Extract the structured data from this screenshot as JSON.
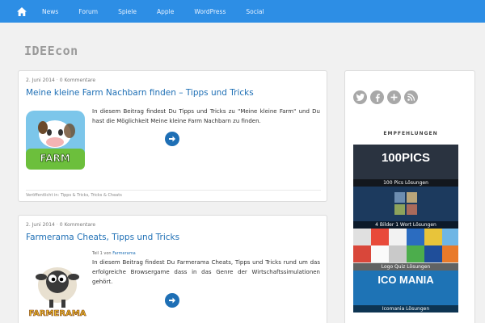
{
  "nav": {
    "items": [
      "News",
      "Forum",
      "Spiele",
      "Apple",
      "WordPress",
      "Social"
    ]
  },
  "logo": "IDEEcon",
  "posts": [
    {
      "date": "2. Juni 2014",
      "comments": "0 Kommentare",
      "title": "Meine kleine Farm Nachbarn finden – Tipps und Tricks",
      "text": "In diesem Beitrag findest Du Tipps und Tricks zu \"Meine kleine Farm\" und Du hast die Möglichkeit Meine kleine Farm Nachbarn zu finden.",
      "footer": "Veröffentlicht in: Tipps & Tricks, Tricks & Cheats",
      "thumb_text": "FARM"
    },
    {
      "date": "2. Juni 2014",
      "comments": "0 Kommentare",
      "title": "Farmerama Cheats, Tipps und Tricks",
      "caption_prefix": "Teil 1 von",
      "caption_link": "Farmerama",
      "text": "In diesem Beitrag findest Du Farmerama Cheats, Tipps und Tricks rund um das erfolgreiche Browsergame dass in das Genre der Wirtschaftssimulationen gehört.",
      "thumb_text": "FARMERAMA"
    }
  ],
  "sidebar": {
    "heading": "EMPFEHLUNGEN",
    "social": [
      "t",
      "f",
      "+",
      "rss"
    ],
    "banners": [
      {
        "title": "100PICS",
        "label": "100 Pics Lösungen"
      },
      {
        "title": "",
        "label": "4 Bilder 1 Wort Lösungen"
      },
      {
        "title": "",
        "label": "Logo Quiz Lösungen"
      },
      {
        "title": "ICO MANIA",
        "label": "Icomania Lösungen"
      }
    ]
  },
  "colors": {
    "nav_bg": "#2d8ee5",
    "link": "#1e6fb5"
  }
}
